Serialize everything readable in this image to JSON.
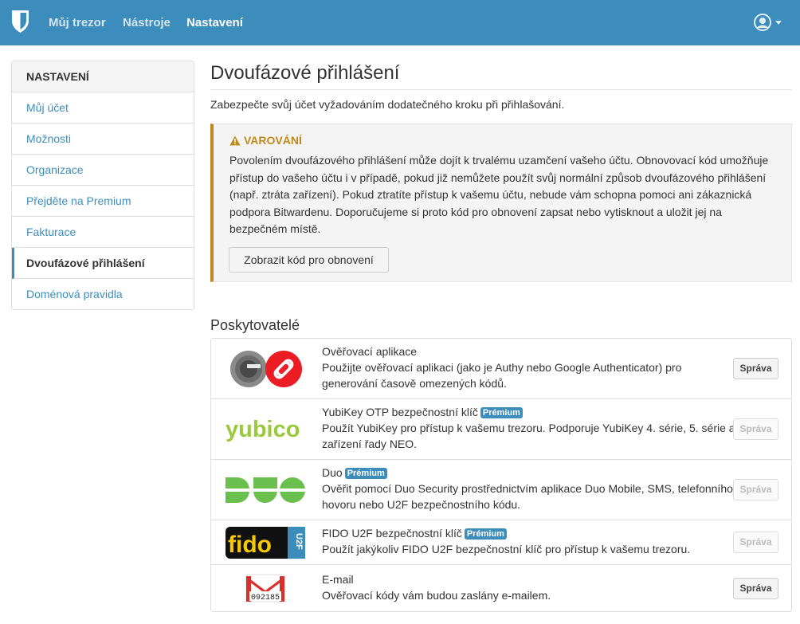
{
  "navbar": {
    "links": [
      "Můj trezor",
      "Nástroje",
      "Nastavení"
    ],
    "active_index": 2,
    "brand_icon": "shield-icon",
    "user_icon": "user-circle-icon",
    "color": "#3c8dbc"
  },
  "sidebar": {
    "heading": "NASTAVENÍ",
    "items": [
      {
        "label": "Můj účet"
      },
      {
        "label": "Možnosti"
      },
      {
        "label": "Organizace"
      },
      {
        "label": "Přejděte na Premium"
      },
      {
        "label": "Fakturace"
      },
      {
        "label": "Dvoufázové přihlášení",
        "active": true
      },
      {
        "label": "Doménová pravidla"
      }
    ]
  },
  "main": {
    "title": "Dvoufázové přihlášení",
    "lead": "Zabezpečte svůj účet vyžadováním dodatečného kroku při přihlašování.",
    "warning": {
      "icon": "warning-triangle-icon",
      "title": "VAROVÁNÍ",
      "body": "Povolením dvoufázového přihlášení může dojít k trvalému uzamčení vašeho účtu. Obnovovací kód umožňuje přístup do vašeho účtu i v případě, pokud již nemůžete použít svůj normální způsob dvoufázového přihlášení (např. ztráta zařízení). Pokud ztratíte přístup k vašemu účtu, nebude vám schopna pomoci ani zákaznická podpora Bitwardenu. Doporučujeme si proto kód pro obnovení zapsat nebo vytisknout a uložit jej na bezpečném místě.",
      "button": "Zobrazit kód pro obnovení",
      "color": "#c0891b"
    },
    "providers_heading": "Poskytovatelé",
    "providers": [
      {
        "name": "Ověřovací aplikace",
        "premium": false,
        "description": "Použijte ověřovací aplikaci (jako je Authy nebo Google Authenticator) pro generování časově omezených kódů.",
        "button": "Správa",
        "enabled": true,
        "logo": "authenticator-logo"
      },
      {
        "name": "YubiKey OTP bezpečnostní klíč",
        "premium": true,
        "description": "Použít YubiKey pro přístup k vašemu trezoru. Podporuje YubiKey 4. série, 5. série a zařízení řady NEO.",
        "button": "Správa",
        "enabled": false,
        "logo": "yubico-logo",
        "logo_text": "yubico"
      },
      {
        "name": "Duo",
        "premium": true,
        "description": "Ověřit pomocí Duo Security prostřednictvím aplikace Duo Mobile, SMS, telefonního hovoru nebo U2F bezpečnostního kódu.",
        "button": "Správa",
        "enabled": false,
        "logo": "duo-logo"
      },
      {
        "name": "FIDO U2F bezpečnostní klíč",
        "premium": true,
        "description": "Použít jakýkoliv FIDO U2F bezpečnostní klíč pro přístup k vašemu trezoru.",
        "button": "Správa",
        "enabled": false,
        "logo": "fido-u2f-logo",
        "logo_text": "fido"
      },
      {
        "name": "E-mail",
        "premium": false,
        "description": "Ověřovací kódy vám budou zaslány e-mailem.",
        "button": "Správa",
        "enabled": true,
        "logo": "gmail-logo",
        "logo_text": "092185"
      }
    ],
    "premium_badge": "Prémium"
  }
}
